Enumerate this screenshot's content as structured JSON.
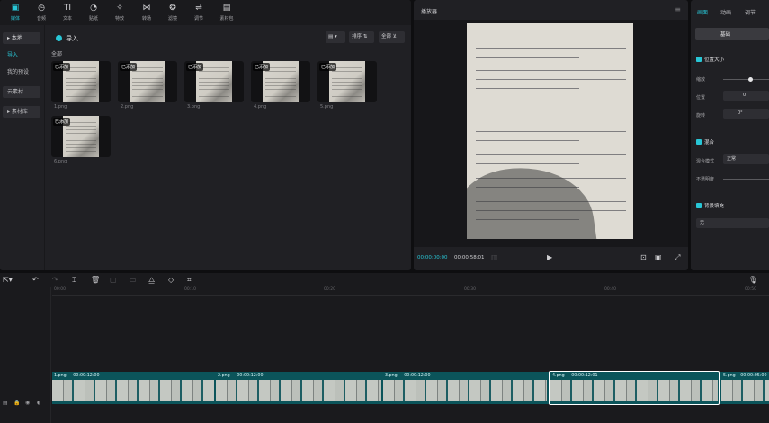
{
  "toolbar": [
    {
      "label": "媒体",
      "icon": "media-icon",
      "glyph": "▣",
      "active": true
    },
    {
      "label": "音频",
      "icon": "audio-icon",
      "glyph": "◷"
    },
    {
      "label": "文本",
      "icon": "text-icon",
      "glyph": "TI"
    },
    {
      "label": "贴纸",
      "icon": "sticker-icon",
      "glyph": "◔"
    },
    {
      "label": "特效",
      "icon": "effects-icon",
      "glyph": "✧"
    },
    {
      "label": "转场",
      "icon": "transition-icon",
      "glyph": "⋈"
    },
    {
      "label": "滤镜",
      "icon": "filter-icon",
      "glyph": "❂"
    },
    {
      "label": "调节",
      "icon": "adjust-icon",
      "glyph": "⇌"
    },
    {
      "label": "素材包",
      "icon": "asset-pack-icon",
      "glyph": "▤"
    }
  ],
  "sidebar": {
    "items": [
      {
        "label": "▸ 本地"
      },
      {
        "label": "导入"
      },
      {
        "label": "我的预设"
      },
      {
        "label": "云素材"
      },
      {
        "label": "▸ 素材库"
      }
    ]
  },
  "media": {
    "import_label": "导入",
    "sort_label": "排序 ⇅",
    "filter_label": "全部 ⊻",
    "view_label": "▤ ▾",
    "all_label": "全部",
    "items": [
      {
        "name": "1.png",
        "badge": "已添加"
      },
      {
        "name": "2.png",
        "badge": "已添加"
      },
      {
        "name": "3.png",
        "badge": "已添加"
      },
      {
        "name": "4.png",
        "badge": "已添加"
      },
      {
        "name": "5.png",
        "badge": "已添加"
      },
      {
        "name": "6.png",
        "badge": "已添加"
      }
    ]
  },
  "player": {
    "title": "播放器",
    "current_time": "00:00:00:00",
    "total_time": "00:00:58:01",
    "menu_icon": "≡"
  },
  "inspector": {
    "tabs": [
      "画面",
      "动画",
      "调节"
    ],
    "sub_tab": "基础",
    "section_position": "位置大小",
    "scale_label": "缩放",
    "position_label": "位置",
    "position_value": "0",
    "rotate_label": "旋转",
    "rotate_value": "0°",
    "section_blend": "混合",
    "blend_mode_label": "混合模式",
    "blend_mode_value": "正常",
    "opacity_label": "不透明度",
    "section_bg": "背景填充",
    "bg_value": "无"
  },
  "timeline": {
    "ruler_ticks": [
      "00:00",
      "00:10",
      "00:20",
      "00:30",
      "00:40",
      "00:50"
    ],
    "clips": [
      {
        "name": "1.png",
        "duration": "00:00:12:00"
      },
      {
        "name": "2.png",
        "duration": "00:00:12:00"
      },
      {
        "name": "3.png",
        "duration": "00:00:12:00"
      },
      {
        "name": "4.png",
        "duration": "00:00:12:01"
      },
      {
        "name": "5.png",
        "duration": "00:00:05:00"
      }
    ]
  },
  "colors": {
    "accent": "#28c6d6",
    "track": "#0b545a",
    "panel": "#202024"
  }
}
